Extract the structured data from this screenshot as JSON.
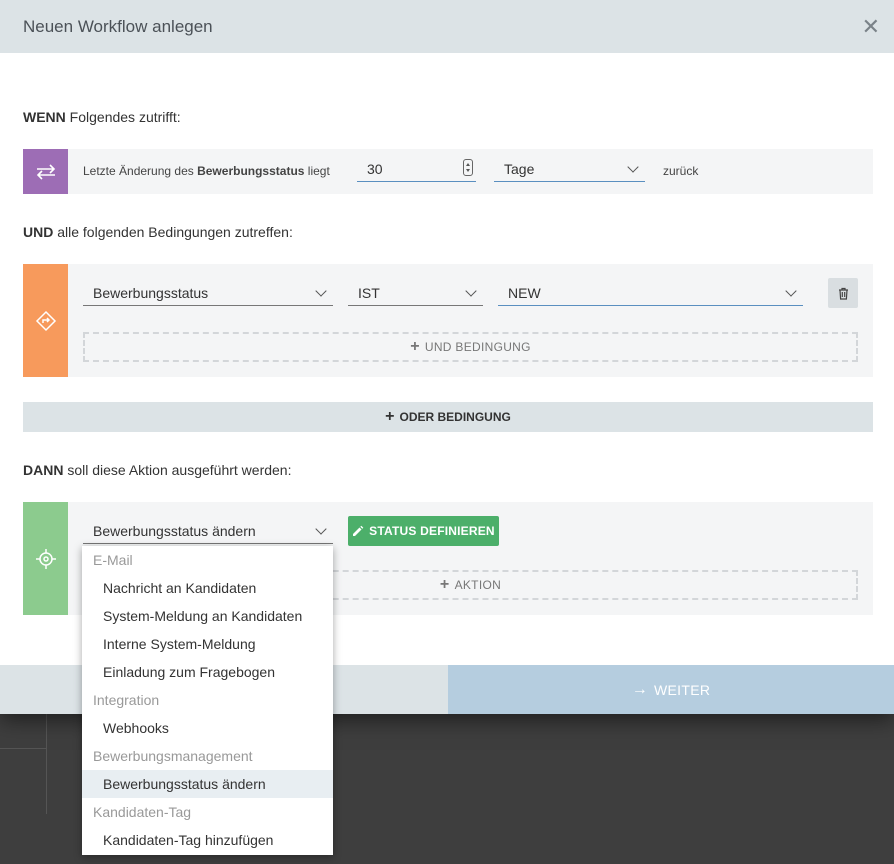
{
  "modal": {
    "title": "Neuen Workflow anlegen",
    "close_icon": "close-icon"
  },
  "when": {
    "label_bold": "WENN",
    "label_rest": " Folgendes zutrifft:",
    "icon": "swap-arrows-icon",
    "icon_color": "#9d6db5",
    "text_prefix": "Letzte Änderung des ",
    "text_bold": "Bewerbungsstatus",
    "text_suffix": " liegt",
    "number_value": "30",
    "unit_value": "Tage",
    "text_after": "zurück"
  },
  "and": {
    "label_bold": "UND",
    "label_rest": " alle folgenden Bedingungen zutreffen:",
    "icon": "diamond-arrow-icon",
    "icon_color": "#f79a5c",
    "field_value": "Bewerbungsstatus",
    "operator_value": "IST",
    "value_value": "NEW",
    "trash_icon": "trash-icon",
    "add_condition_label": "UND BEDINGUNG"
  },
  "or_button_label": "ODER BEDINGUNG",
  "then": {
    "label_bold": "DANN",
    "label_rest": " soll diese Aktion ausgeführt werden:",
    "icon": "target-icon",
    "icon_color": "#8ccb8e",
    "action_value": "Bewerbungsstatus ändern",
    "define_status_label": "STATUS DEFINIEREN",
    "add_action_label": "AKTION"
  },
  "footer": {
    "next_label": "WEITER",
    "next_color": "#b5cddf"
  },
  "dropdown": {
    "groups": [
      {
        "name": "E-Mail",
        "items": [
          "Nachricht an Kandidaten",
          "System-Meldung an Kandidaten",
          "Interne System-Meldung",
          "Einladung zum Fragebogen"
        ]
      },
      {
        "name": "Integration",
        "items": [
          "Webhooks"
        ]
      },
      {
        "name": "Bewerbungsmanagement",
        "items": [
          "Bewerbungsstatus ändern"
        ]
      },
      {
        "name": "Kandidaten-Tag",
        "items": [
          "Kandidaten-Tag hinzufügen"
        ]
      }
    ],
    "selected_item": "Bewerbungsstatus ändern"
  }
}
